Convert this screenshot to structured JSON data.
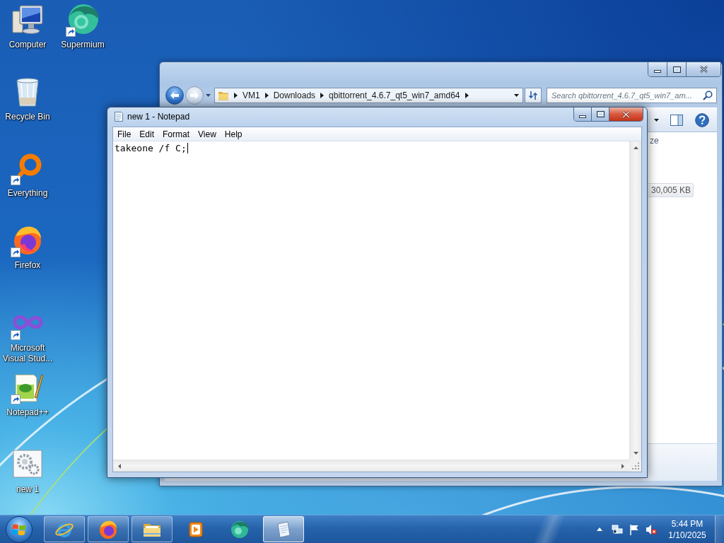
{
  "desktop_icons": [
    {
      "label": "Computer",
      "kind": "monitor",
      "shortcut": false
    },
    {
      "label": "Supermium",
      "kind": "sphere",
      "shortcut": true
    },
    {
      "label": "Recycle Bin",
      "kind": "bin",
      "shortcut": false
    },
    {
      "label": "Everything",
      "kind": "ring",
      "shortcut": true
    },
    {
      "label": "Firefox",
      "kind": "fox",
      "shortcut": true
    },
    {
      "label": "Microsoft Visual Stud...",
      "kind": "infinity",
      "shortcut": true
    },
    {
      "label": "Notepad++",
      "kind": "notebook",
      "shortcut": true
    },
    {
      "label": "new 1",
      "kind": "gears",
      "shortcut": false
    }
  ],
  "explorer": {
    "back": {
      "disabled": false
    },
    "forward": {
      "disabled": true
    },
    "breadcrumb": [
      "VM1",
      "Downloads",
      "qbittorrent_4.6.7_qt5_win7_amd64"
    ],
    "search": {
      "placeholder": "Search qbittorrent_4.6.7_qt5_win7_am..."
    },
    "columns": [
      "ze"
    ],
    "rows": [
      {
        "cells": [
          "30,005 KB"
        ],
        "selected": true
      }
    ]
  },
  "notepad": {
    "title": "new 1 - Notepad",
    "menu": [
      "File",
      "Edit",
      "Format",
      "View",
      "Help"
    ],
    "text": "takeone /f C;"
  },
  "taskbar": {
    "items": [
      {
        "kind": "ie",
        "running": true,
        "selected": false
      },
      {
        "kind": "fox",
        "running": true,
        "selected": false
      },
      {
        "kind": "folder",
        "running": true,
        "selected": false
      },
      {
        "kind": "player",
        "running": false,
        "selected": false
      },
      {
        "kind": "sphere",
        "running": false,
        "selected": false
      },
      {
        "kind": "notepad",
        "running": true,
        "selected": true
      }
    ],
    "volume_muted": true,
    "clock": {
      "time": "5:44 PM",
      "date": "1/10/2025"
    }
  }
}
